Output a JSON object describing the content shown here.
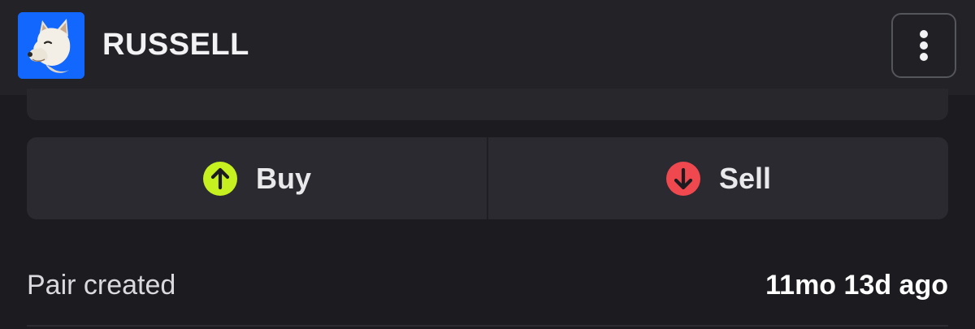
{
  "header": {
    "token_name": "RUSSELL",
    "logo_icon": "shiba-dog-logo",
    "logo_bg": "#1267ff",
    "menu_icon": "vertical-ellipsis-icon"
  },
  "trade": {
    "buy_label": "Buy",
    "buy_icon": "arrow-up-circle-icon",
    "buy_color": "#c6f01f",
    "sell_label": "Sell",
    "sell_icon": "arrow-down-circle-icon",
    "sell_color": "#f0484f"
  },
  "info": {
    "pair_created_label": "Pair created",
    "pair_created_value": "11mo 13d ago"
  }
}
